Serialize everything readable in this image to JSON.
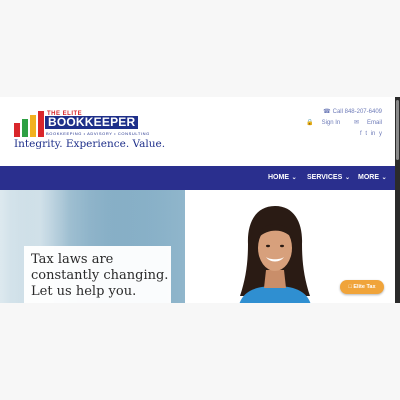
{
  "header": {
    "logo": {
      "the_elite": "THE ELITE",
      "name": "BOOKKEEPER",
      "subline": "BOOKKEEPING • ADVISORY • CONSULTING"
    },
    "tagline": "Integrity. Experience. Value.",
    "contact": {
      "phone": "Call 848-207-6409",
      "sign_in": "Sign In",
      "email": "Email"
    }
  },
  "nav": {
    "items": [
      {
        "label": "HOME"
      },
      {
        "label": "SERVICES"
      },
      {
        "label": "MORE"
      }
    ]
  },
  "hero": {
    "lines": [
      "Tax laws are",
      "constantly changing.",
      "Let us help you."
    ]
  },
  "floating_button": {
    "label": "Elite Tax"
  },
  "colors": {
    "brand_blue": "#2a2f8e",
    "logo_red": "#d9262b",
    "accent_orange": "#f0a43a"
  }
}
